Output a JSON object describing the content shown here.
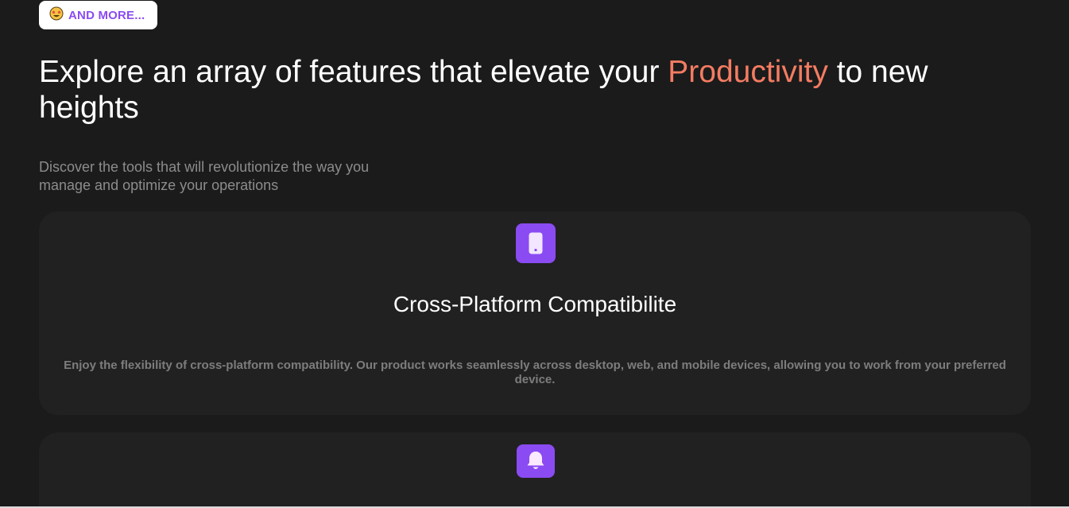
{
  "badge": {
    "emoji_icon": "star-struck-emoji-icon",
    "label": "AND MORE..."
  },
  "headline": {
    "before": "Explore an array of features that elevate your ",
    "accent": "Productivity",
    "after": " to new heights",
    "accent_color": "#f47c62"
  },
  "subtitle": "Discover the tools that will revolutionize the way you manage and optimize your operations",
  "features": [
    {
      "icon": "smartphone-icon",
      "title": "Cross-Platform Compatibilite",
      "description": "Enjoy the flexibility of cross-platform compatibility. Our product works seamlessly across desktop, web, and mobile devices, allowing you to work from your preferred device."
    },
    {
      "icon": "bell-icon"
    }
  ],
  "colors": {
    "background": "#1b1b1b",
    "card": "#212121",
    "brand_purple": "#8a4bf2"
  }
}
